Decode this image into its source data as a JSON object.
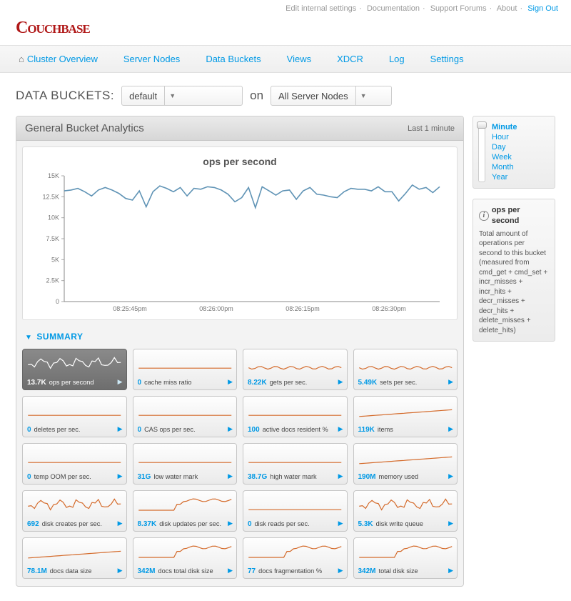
{
  "top_links": {
    "edit": "Edit internal settings",
    "docs": "Documentation",
    "support": "Support Forums",
    "about": "About",
    "signout": "Sign Out"
  },
  "logo": "COUCHBASE",
  "nav": {
    "overview": "Cluster Overview",
    "nodes": "Server Nodes",
    "buckets": "Data Buckets",
    "views": "Views",
    "xdcr": "XDCR",
    "log": "Log",
    "settings": "Settings"
  },
  "selector": {
    "label": "DATA BUCKETS:",
    "bucket": "default",
    "on": "on",
    "scope": "All Server Nodes"
  },
  "panel": {
    "title": "General Bucket Analytics",
    "range": "Last 1 minute"
  },
  "time_opts": {
    "minute": "Minute",
    "hour": "Hour",
    "day": "Day",
    "week": "Week",
    "month": "Month",
    "year": "Year"
  },
  "info": {
    "title": "ops per second",
    "body": "Total amount of operations per second to this bucket (measured from cmd_get + cmd_set + incr_misses + incr_hits + decr_misses + decr_hits + delete_misses + delete_hits)"
  },
  "summary_label": "SUMMARY",
  "tiles": [
    {
      "v": "13.7K",
      "l": "ops per second",
      "sel": true,
      "sp": "jitter"
    },
    {
      "v": "0",
      "l": "cache miss ratio",
      "sp": "flat"
    },
    {
      "v": "8.22K",
      "l": "gets per sec.",
      "sp": "jlow"
    },
    {
      "v": "5.49K",
      "l": "sets per sec.",
      "sp": "jlow"
    },
    {
      "v": "0",
      "l": "deletes per sec.",
      "sp": "flat"
    },
    {
      "v": "0",
      "l": "CAS ops per sec.",
      "sp": "flat"
    },
    {
      "v": "100",
      "l": "active docs resident %",
      "sp": "flat"
    },
    {
      "v": "119K",
      "l": "items",
      "sp": "rise"
    },
    {
      "v": "0",
      "l": "temp OOM per sec.",
      "sp": "flat"
    },
    {
      "v": "31G",
      "l": "low water mark",
      "sp": "flat"
    },
    {
      "v": "38.7G",
      "l": "high water mark",
      "sp": "flat"
    },
    {
      "v": "190M",
      "l": "memory used",
      "sp": "rise"
    },
    {
      "v": "692",
      "l": "disk creates per sec.",
      "sp": "jitter"
    },
    {
      "v": "8.37K",
      "l": "disk updates per sec.",
      "sp": "step"
    },
    {
      "v": "0",
      "l": "disk reads per sec.",
      "sp": "flat"
    },
    {
      "v": "5.3K",
      "l": "disk write queue",
      "sp": "jitter"
    },
    {
      "v": "78.1M",
      "l": "docs data size",
      "sp": "rise"
    },
    {
      "v": "342M",
      "l": "docs total disk size",
      "sp": "step"
    },
    {
      "v": "77",
      "l": "docs fragmentation %",
      "sp": "step"
    },
    {
      "v": "342M",
      "l": "total disk size",
      "sp": "step"
    }
  ],
  "chart_data": {
    "type": "line",
    "title": "ops per second",
    "ylabel": "",
    "xlabel": "",
    "ylim": [
      0,
      15000
    ],
    "y_ticks": [
      "0",
      "2.5K",
      "5K",
      "7.5K",
      "10K",
      "12.5K",
      "15K"
    ],
    "x_ticks": [
      "08:25:45pm",
      "08:26:00pm",
      "08:26:15pm",
      "08:26:30pm"
    ],
    "series": [
      {
        "name": "ops",
        "values": [
          13200,
          13300,
          13500,
          13100,
          12600,
          13300,
          13600,
          13300,
          12900,
          12300,
          12100,
          13200,
          11300,
          13100,
          13800,
          13500,
          13100,
          13600,
          12600,
          13500,
          13400,
          13700,
          13600,
          13300,
          12800,
          11900,
          12400,
          13600,
          11200,
          13700,
          13200,
          12700,
          13200,
          13300,
          12200,
          13200,
          13600,
          12800,
          12700,
          12500,
          12400,
          13100,
          13500,
          13400,
          13400,
          13200,
          13700,
          13100,
          13100,
          12000,
          12900,
          13900,
          13400,
          13600,
          13000,
          13700
        ]
      }
    ]
  }
}
